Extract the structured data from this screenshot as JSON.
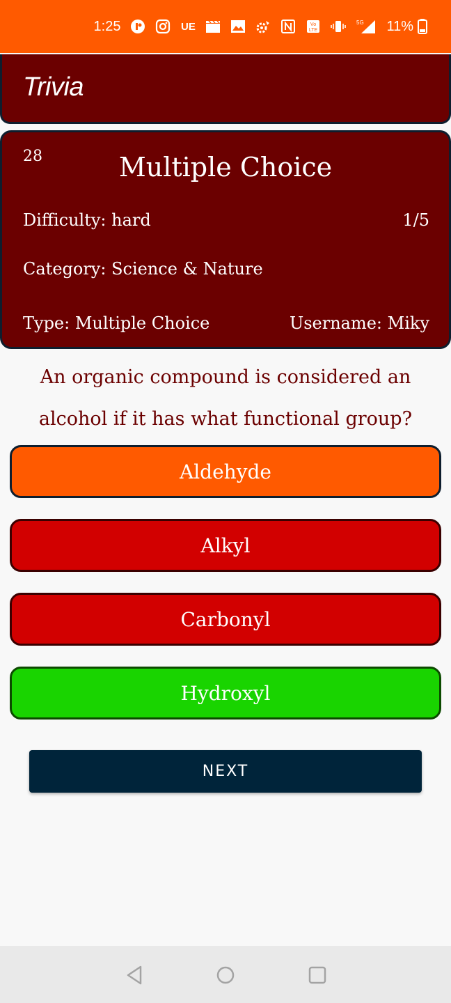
{
  "status_bar": {
    "time": "1:25",
    "battery": "11%",
    "network": "5G",
    "icons": [
      "media-icon",
      "instagram-icon",
      "ue-icon",
      "clapper-icon",
      "image-icon",
      "settings-icon",
      "nfc-icon",
      "volte-icon",
      "vibrate-icon",
      "signal-icon",
      "battery-icon"
    ],
    "accent_color": "#ff5a00"
  },
  "app_bar": {
    "title": "Trivia"
  },
  "question_card": {
    "counter": "28",
    "title": "Multiple Choice",
    "difficulty": "Difficulty: hard",
    "progress": "1/5",
    "category": "Category: Science & Nature",
    "type": "Type: Multiple Choice",
    "username": "Username: Miky"
  },
  "question": {
    "text": "An organic compound is considered an alcohol if it has what functional group?"
  },
  "answers": [
    {
      "label": "Aldehyde",
      "color": "#ff5a00"
    },
    {
      "label": "Alkyl",
      "color": "#d20000"
    },
    {
      "label": "Carbonyl",
      "color": "#d20000"
    },
    {
      "label": "Hydroxyl",
      "color": "#19d400"
    }
  ],
  "next_button": {
    "label": "NEXT"
  },
  "nav_bar": {
    "icons": [
      "back-icon",
      "home-icon",
      "recents-icon"
    ]
  }
}
